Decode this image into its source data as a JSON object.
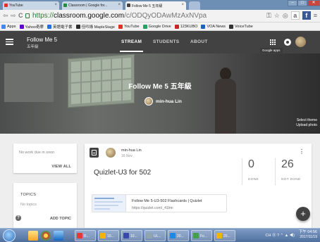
{
  "browser": {
    "tabs": [
      {
        "label": "YouTube",
        "color": "#e52d27"
      },
      {
        "label": "Classroom | Google for...",
        "color": "#1e8e3e"
      },
      {
        "label": "Follow Me 5 五年級",
        "color": "#424242"
      }
    ],
    "window_buttons": {
      "minimize": "–",
      "maximize": "□",
      "close": "✕"
    },
    "nav": {
      "back": "⇦",
      "forward": "⇨",
      "reload": "C"
    },
    "url": {
      "proto": "https://",
      "host": "classroom.google.com",
      "path": "/c/ODQyODAwMzAxNVpa"
    },
    "amazon_label": "a",
    "facebook_label": "f",
    "bookmarks": [
      {
        "label": "Apps",
        "color": "#4285f4"
      },
      {
        "label": "Yahoo奇摩",
        "color": "#6001d2"
      },
      {
        "label": "英語電子書",
        "color": "#1a73e8"
      },
      {
        "label": "佳吟綠 MapleStage",
        "color": "#2b2b2b"
      },
      {
        "label": "YouTube",
        "color": "#e52d27"
      },
      {
        "label": "Google Drive",
        "color": "#1fa463"
      },
      {
        "label": "123KUBO",
        "color": "#c62828"
      },
      {
        "label": "VOA News",
        "color": "#1565c0"
      },
      {
        "label": "VoiceTube",
        "color": "#333333"
      }
    ]
  },
  "topbar": {
    "class_name": "Follow Me 5",
    "class_section": "五年級",
    "tabs": [
      "STREAM",
      "STUDENTS",
      "ABOUT"
    ],
    "active_tab": "STREAM",
    "tooltip": "Google apps"
  },
  "banner": {
    "title": "Follow Me 5 五年級",
    "teacher": "min-hua Lin",
    "select_theme": "Select theme",
    "upload_photo": "Upload photo"
  },
  "upcoming": {
    "text": "No work due in soon",
    "view_all": "VIEW ALL"
  },
  "topics": {
    "header": "TOPICS",
    "empty": "No topics",
    "add": "ADD TOPIC",
    "help": "?"
  },
  "post": {
    "author": "min-hua Lin",
    "date": "16 Nov",
    "more": "⋮",
    "title": "Quizlet-U3 for 502",
    "done_count": "0",
    "done_label": "DONE",
    "not_done_count": "26",
    "not_done_label": "NOT DONE",
    "attachment_title": "Follow Me 5-U3-502 Flashcards | Quizlet",
    "attachment_url": "https://quizlet.com/_41lmi"
  },
  "fab_label": "+",
  "taskbar": {
    "items": [
      {
        "label": "R...",
        "color": "#e53935"
      },
      {
        "label": "10...",
        "color": "#f4b400"
      },
      {
        "label": "10...",
        "color": "#3949ab"
      },
      {
        "label": "UL...",
        "color": "#90a4ae"
      },
      {
        "label": "20...",
        "color": "#1e88e5"
      },
      {
        "label": "Fo...",
        "color": "#43a047"
      },
      {
        "label": "20...",
        "color": "#f4b400"
      }
    ],
    "tray_text": "CH ⓪ ? ⌃ ▲ ◀)",
    "time": "下午 04:56",
    "date": "2017/11/19"
  }
}
